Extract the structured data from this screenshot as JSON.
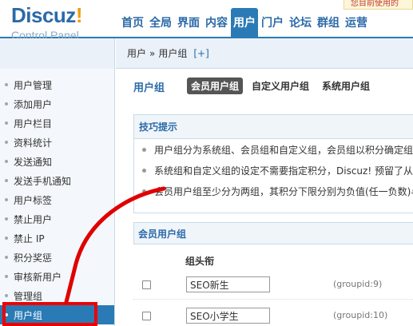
{
  "logo": {
    "name": "Discuz",
    "bang": "!",
    "subtitle": "Control Panel"
  },
  "topnav": [
    "首页",
    "全局",
    "界面",
    "内容",
    "用户",
    "门户",
    "论坛",
    "群组",
    "运营"
  ],
  "topnav_active": 4,
  "notice": "您目前使用的",
  "breadcrumb": {
    "root": "用户",
    "sep": "»",
    "current": "用户组",
    "add": "[+]"
  },
  "sidebar": {
    "items": [
      "用户管理",
      "添加用户",
      "用户栏目",
      "资料统计",
      "发送通知",
      "发送手机通知",
      "用户标签",
      "禁止用户",
      "禁止 IP",
      "积分奖惩",
      "审核新用户",
      "管理组",
      "用户组"
    ],
    "active": 12
  },
  "page": {
    "title": "用户组",
    "tabs": [
      "会员用户组",
      "自定义用户组",
      "系统用户组"
    ],
    "active_tab": 0
  },
  "tips": {
    "title": "技巧提示",
    "items": [
      "用户组分为系统组、会员组和自定义组，会员组以积分确定组",
      "系统组和自定义组的设定不需要指定积分，Discuz! 预留了从",
      "会员用户组至少分为两组，其积分下限分别为负值(任一负数)与"
    ]
  },
  "groups": {
    "title": "会员用户组",
    "col_name": "组头衔",
    "rows": [
      {
        "name": "SEO新生",
        "gid": "(groupid:9)"
      },
      {
        "name": "SEO小学生",
        "gid": "(groupid:10)"
      }
    ]
  },
  "colors": {
    "brand": "#2a7bb5",
    "highlight": "#e00000"
  }
}
